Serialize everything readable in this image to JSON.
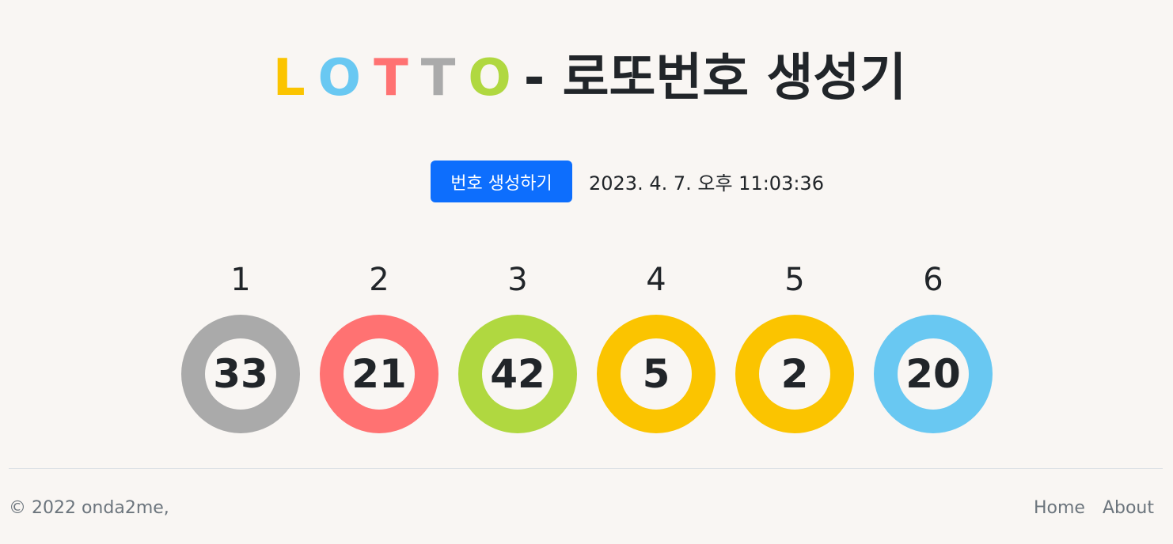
{
  "title": {
    "letters": [
      {
        "char": "L",
        "color": "#fbc400"
      },
      {
        "char": "O",
        "color": "#69c8f2"
      },
      {
        "char": "T",
        "color": "#ff7272"
      },
      {
        "char": "T",
        "color": "#aaaaaa"
      },
      {
        "char": "O",
        "color": "#b0d840"
      }
    ],
    "rest": "- 로또번호 생성기",
    "rest_color": "#212529"
  },
  "controls": {
    "generate_label": "번호 생성하기",
    "generate_color": "#0d6efd",
    "timestamp": "2023. 4. 7. 오후 11:03:36"
  },
  "balls": [
    {
      "index": "1",
      "number": "33",
      "color": "#aaaaaa"
    },
    {
      "index": "2",
      "number": "21",
      "color": "#ff7272"
    },
    {
      "index": "3",
      "number": "42",
      "color": "#b0d840"
    },
    {
      "index": "4",
      "number": "5",
      "color": "#fbc400"
    },
    {
      "index": "5",
      "number": "2",
      "color": "#fbc400"
    },
    {
      "index": "6",
      "number": "20",
      "color": "#69c8f2"
    }
  ],
  "footer": {
    "copyright": "© 2022 onda2me,",
    "links": [
      "Home",
      "About"
    ]
  }
}
